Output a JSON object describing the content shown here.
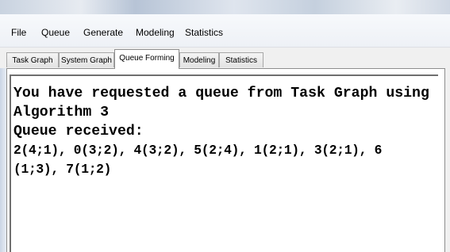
{
  "menu": {
    "items": [
      "File",
      "Queue",
      "Generate",
      "Modeling",
      "Statistics"
    ]
  },
  "tabs": {
    "items": [
      "Task Graph",
      "System Graph",
      "Queue Forming",
      "Modeling",
      "Statistics"
    ],
    "active": "Queue Forming"
  },
  "output": {
    "line1": "You have requested a queue from Task Graph using",
    "line2": "Algorithm 3",
    "line3": "Queue received:",
    "line4": "2(4;1), 0(3;2), 4(3;2), 5(2;4), 1(2;1), 3(2;1), 6",
    "line5": "(1;3), 7(1;2)"
  },
  "colors": {
    "window_background": "#f0f0f0",
    "text_background": "#ffffff",
    "text_color": "#000000"
  }
}
